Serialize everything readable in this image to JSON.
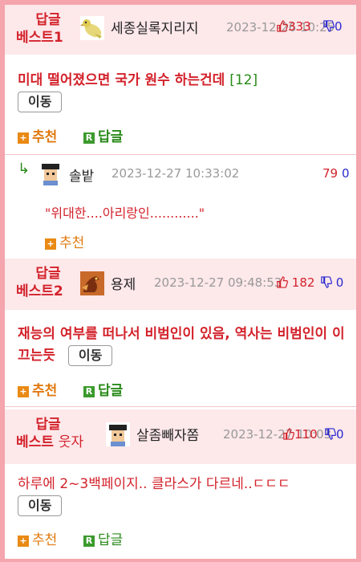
{
  "posts": [
    {
      "badge_line1": "답글",
      "badge_line2": "베스트1",
      "avatar_icon": "bird-avatar-icon",
      "username": "세종실록지리지",
      "date": "2023-12-26 10:25",
      "up": "333",
      "down": "0",
      "title": "미대 떨어졌으면 국가 원수 하는건데",
      "comment_count": "[12]",
      "move_label": "이동",
      "recommend_label": "추천",
      "reply_label": "답글"
    },
    {
      "badge_line1": "답글",
      "badge_line2": "베스트2",
      "avatar_icon": "dragon-avatar-icon",
      "username": "용제",
      "date": "2023-12-27 09:48:53",
      "up": "182",
      "down": "0",
      "title": "재능의 여부를 떠나서 비범인이 있음, 역사는 비범인이 이끄는듯",
      "move_label": "이동",
      "recommend_label": "추천",
      "reply_label": "답글"
    },
    {
      "badge_line1": "답글",
      "badge_line2": "베스트",
      "badge_sub": "웃자",
      "avatar_icon": "scholar-avatar-icon",
      "username": "살좀빼자쫌",
      "date": "2023-12-27 10:03",
      "up": "110",
      "down": "0",
      "title": "하루에 2~3백페이지.. 클라스가 다르네..ㄷㄷㄷ",
      "move_label": "이동",
      "recommend_label": "추천",
      "reply_label": "답글"
    }
  ],
  "comment": {
    "reply_arrow": "↳",
    "avatar_icon": "scholar-avatar-icon",
    "username": "솔밭",
    "date": "2023-12-27 10:33:02",
    "up": "79",
    "down": "0",
    "text": "\"위대한....아리랑인............\"",
    "recommend_label": "추천"
  },
  "colors": {
    "accent_red": "#d3222b",
    "header_bg": "#fde8ea",
    "frame": "#f4a5ad",
    "recommend_orange": "#e98a14",
    "reply_green": "#3b9a2c",
    "down_blue": "#2a2ad0"
  }
}
